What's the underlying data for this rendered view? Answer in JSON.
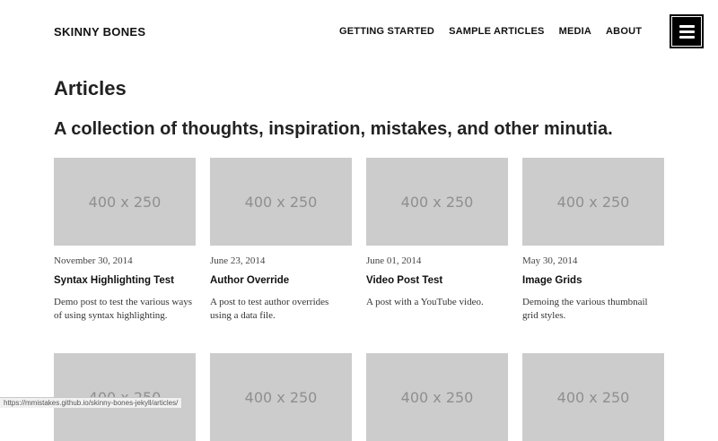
{
  "site": {
    "brand": "SKINNY BONES"
  },
  "nav": {
    "items": [
      "GETTING STARTED",
      "SAMPLE ARTICLES",
      "MEDIA",
      "ABOUT"
    ]
  },
  "page": {
    "title": "Articles",
    "subtitle": "A collection of thoughts, inspiration, mistakes, and other minutia."
  },
  "articles": [
    {
      "thumb": "400 x 250",
      "date": "November 30, 2014",
      "title": "Syntax Highlighting Test",
      "excerpt": "Demo post to test the various ways of using syntax highlighting."
    },
    {
      "thumb": "400 x 250",
      "date": "June 23, 2014",
      "title": "Author Override",
      "excerpt": "A post to test author overrides using a data file."
    },
    {
      "thumb": "400 x 250",
      "date": "June 01, 2014",
      "title": "Video Post Test",
      "excerpt": "A post with a YouTube video."
    },
    {
      "thumb": "400 x 250",
      "date": "May 30, 2014",
      "title": "Image Grids",
      "excerpt": "Demoing the various thumbnail grid styles."
    }
  ],
  "articles_row2": [
    {
      "thumb": "400 x 250"
    },
    {
      "thumb": "400 x 250"
    },
    {
      "thumb": "400 x 250"
    },
    {
      "thumb": "400 x 250"
    }
  ],
  "status_bar": {
    "url": "https://mmistakes.github.io/skinny-bones-jekyll/articles/"
  },
  "icons": {
    "menu": "hamburger-menu-icon"
  },
  "colors": {
    "thumbnail": "#cccccc",
    "menu_button": "#000000",
    "text": "#222222"
  }
}
